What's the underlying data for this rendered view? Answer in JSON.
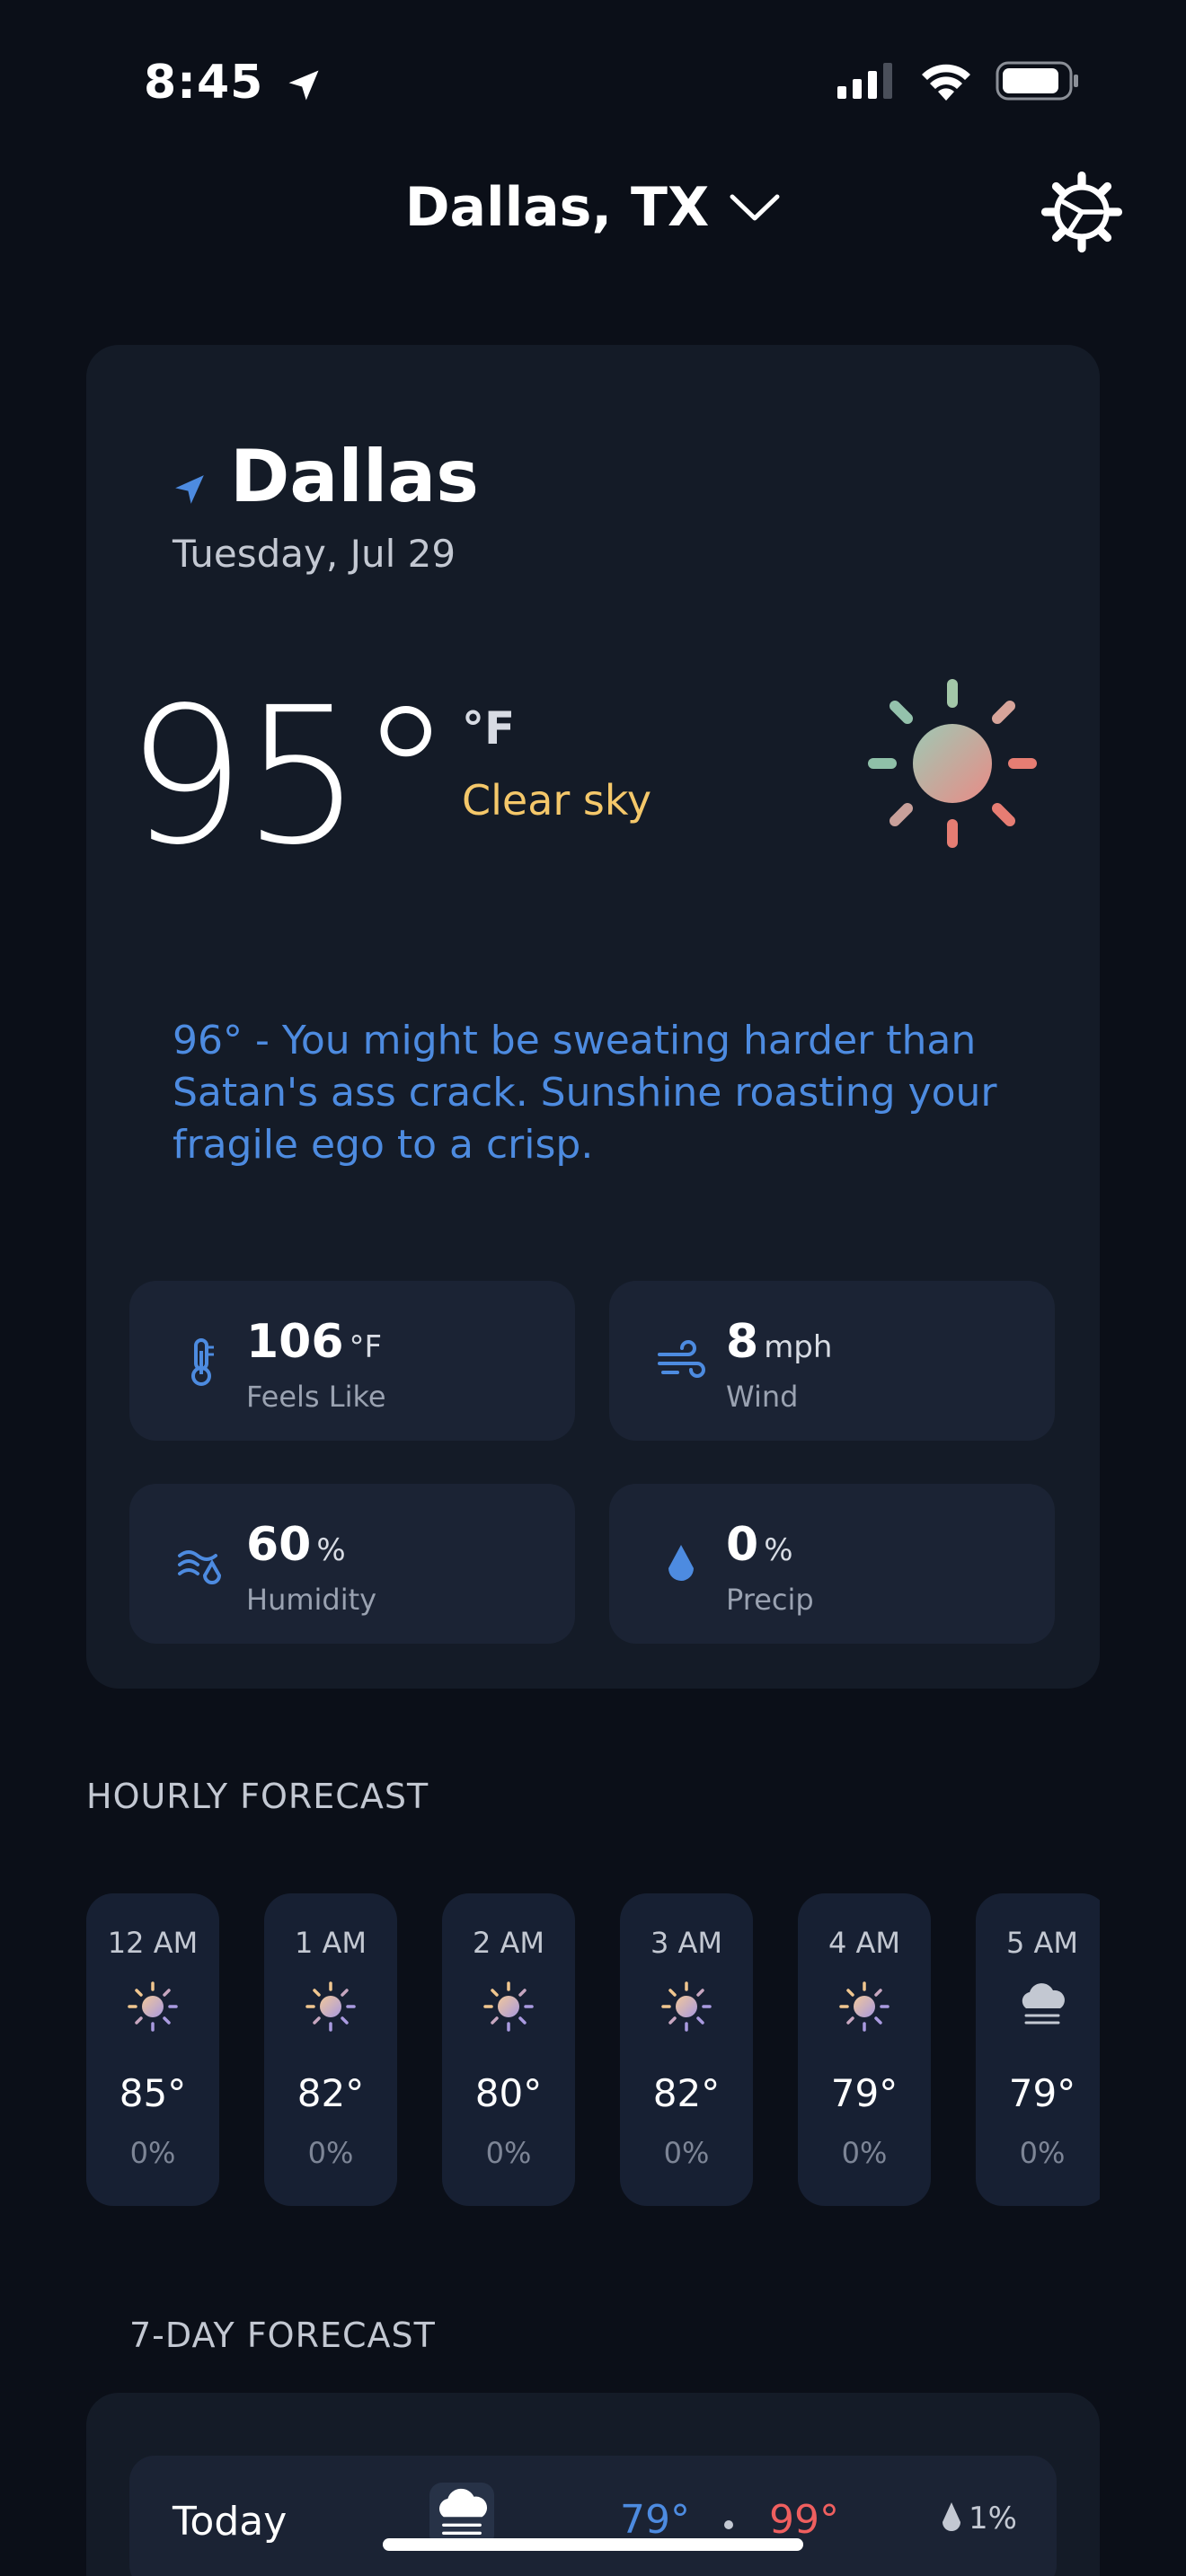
{
  "status_bar": {
    "time": "8:45"
  },
  "header": {
    "location": "Dallas, TX"
  },
  "current": {
    "city": "Dallas",
    "date": "Tuesday, Jul 29",
    "temperature": "95°",
    "unit": "°F",
    "condition": "Clear sky",
    "quip": "96° - You might be sweating harder than Satan's ass crack. Sunshine roasting your fragile ego to a crisp."
  },
  "stats": [
    {
      "value": "106",
      "unit": "°F",
      "label": "Feels Like",
      "icon": "thermometer-icon"
    },
    {
      "value": "8",
      "unit": "mph",
      "label": "Wind",
      "icon": "wind-icon"
    },
    {
      "value": "60",
      "unit": "%",
      "label": "Humidity",
      "icon": "humidity-icon"
    },
    {
      "value": "0",
      "unit": "%",
      "label": "Precip",
      "icon": "raindrop-icon"
    }
  ],
  "hourly": {
    "title": "HOURLY FORECAST",
    "items": [
      {
        "time": "12 AM",
        "temp": "85°",
        "precip": "0%",
        "icon": "sun-icon"
      },
      {
        "time": "1 AM",
        "temp": "82°",
        "precip": "0%",
        "icon": "sun-icon"
      },
      {
        "time": "2 AM",
        "temp": "80°",
        "precip": "0%",
        "icon": "sun-icon"
      },
      {
        "time": "3 AM",
        "temp": "82°",
        "precip": "0%",
        "icon": "sun-icon"
      },
      {
        "time": "4 AM",
        "temp": "79°",
        "precip": "0%",
        "icon": "sun-icon"
      },
      {
        "time": "5 AM",
        "temp": "79°",
        "precip": "0%",
        "icon": "fog-icon"
      }
    ]
  },
  "weekly": {
    "title": "7-DAY FORECAST",
    "days": [
      {
        "day": "Today",
        "low": "79°",
        "high": "99°",
        "precip": "1%",
        "icon": "fog-icon"
      }
    ]
  },
  "colors": {
    "background": "#0b0f18",
    "card": "#141b27",
    "accent_blue": "#4d8be0",
    "condition_yellow": "#f5c86a",
    "high_red": "#ef5f5f"
  }
}
